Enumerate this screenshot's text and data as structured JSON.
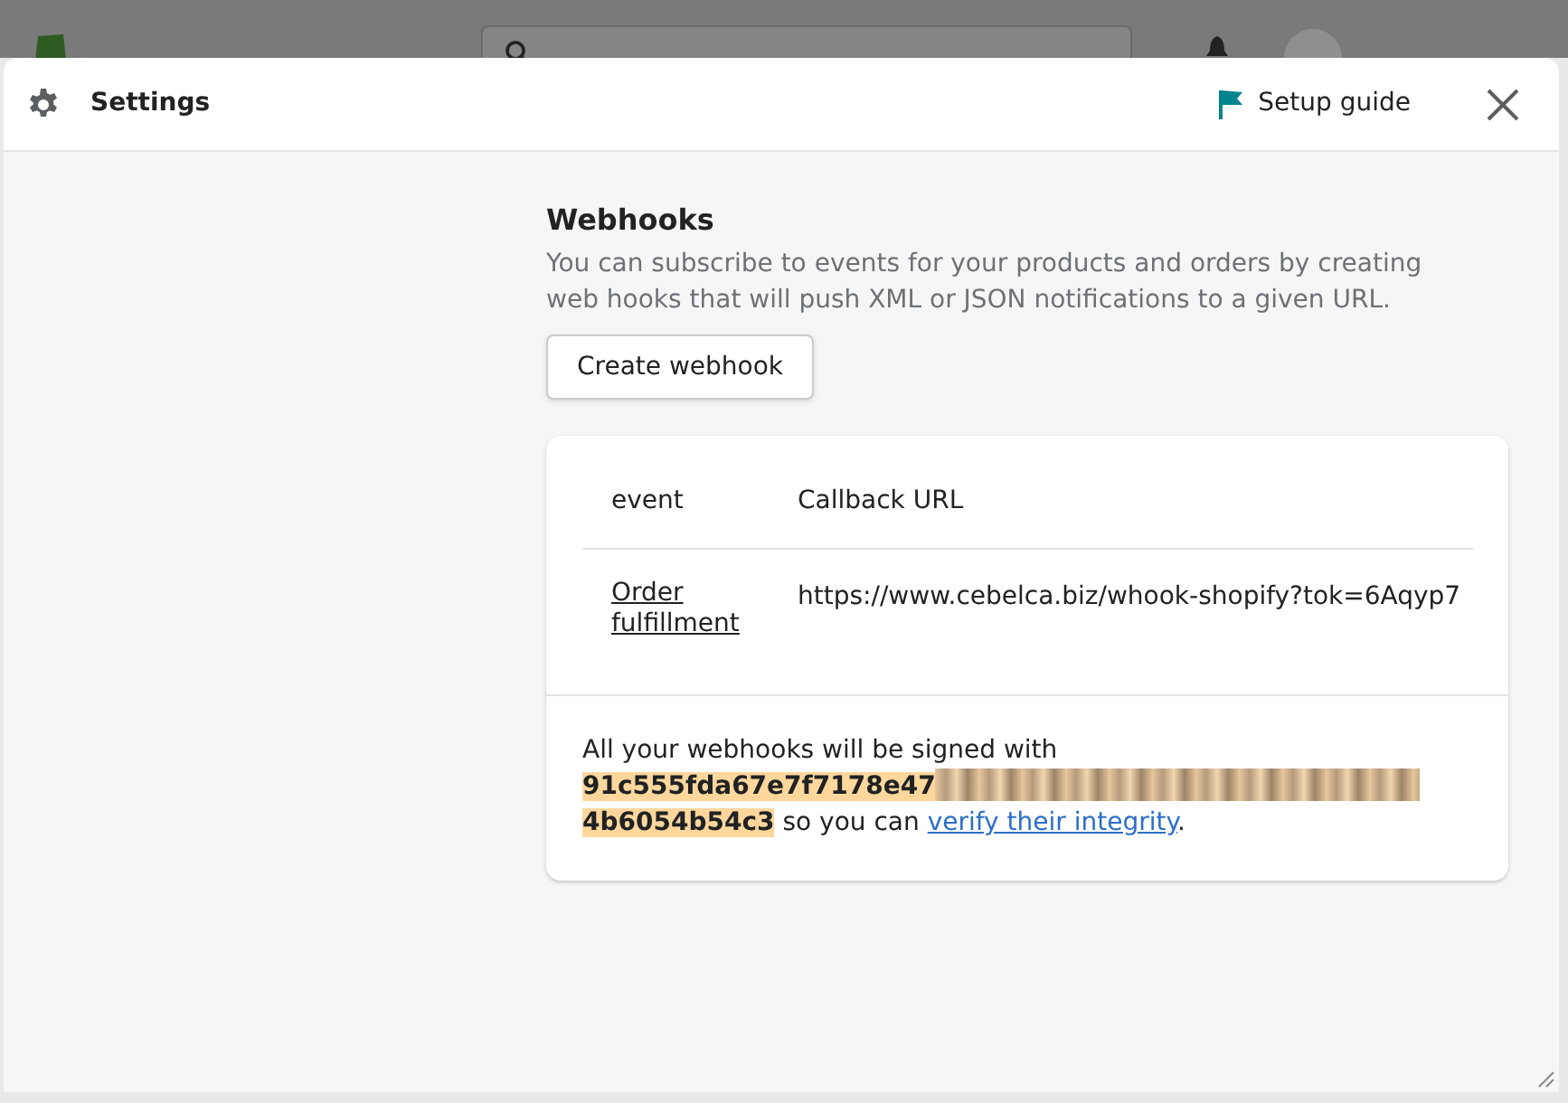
{
  "modal": {
    "title": "Settings",
    "setup_guide": "Setup guide"
  },
  "webhooks": {
    "heading": "Webhooks",
    "description": "You can subscribe to events for your products and orders by creating web hooks that will push XML or JSON notifications to a given URL.",
    "create_button": "Create webhook",
    "table": {
      "columns": [
        "event",
        "Callback URL"
      ],
      "rows": [
        {
          "event": "Order fulfillment",
          "url": "https://www.cebelca.biz/whook-shopify?tok=6Aqyp7"
        }
      ]
    },
    "signature": {
      "before": "All your webhooks will be signed with",
      "key_start": "91c555fda67e7f7178e47",
      "key_end": "4b6054b54c3",
      "after": "so you can",
      "link": "verify their integrity",
      "end": "."
    }
  }
}
